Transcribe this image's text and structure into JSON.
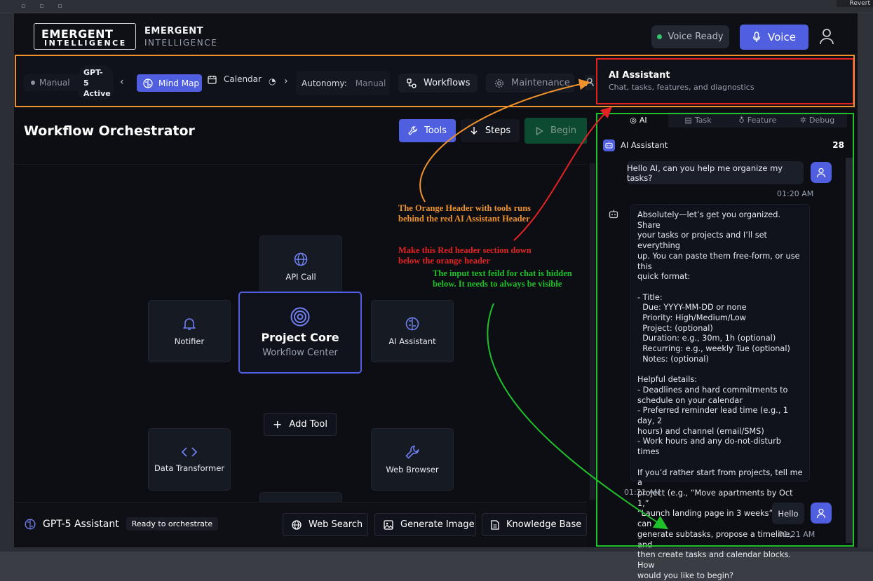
{
  "os": {
    "right_label": "Revert"
  },
  "header": {
    "logo_line1": "EMERGENT",
    "logo_line2": "INTELLIGENCE",
    "brand_title": "EMERGENT",
    "brand_subtitle": "INTELLIGENCE",
    "voice_status": "Voice Ready",
    "voice_button": "Voice"
  },
  "toolbar": {
    "mode": "Manual",
    "model_line1": "GPT-",
    "model_line2": "5",
    "model_line3": "Active",
    "mindmap": "Mind Map",
    "calendar": "Calendar",
    "autonomy_label": "Autonomy:",
    "autonomy_value": "Manual",
    "workflows": "Workflows",
    "maintenance": "Maintenance"
  },
  "assistant_header": {
    "title": "AI Assistant",
    "subtitle": "Chat, tasks, features, and diagnostics"
  },
  "workspace": {
    "title": "Workflow Orchestrator",
    "tools": "Tools",
    "steps": "Steps",
    "begin": "Begin",
    "nodes": {
      "api_call": "API Call",
      "notifier": "Notifier",
      "ai_assistant": "AI Assistant",
      "data_transformer": "Data Transformer",
      "web_browser": "Web Browser"
    },
    "core_title": "Project Core",
    "core_subtitle": "Workflow Center",
    "add_tool": "Add Tool"
  },
  "bottombar": {
    "assistant": "GPT-5 Assistant",
    "status": "Ready to orchestrate",
    "web_search": "Web Search",
    "generate_image": "Generate Image",
    "knowledge_base": "Knowledge Base"
  },
  "chat": {
    "tabs": [
      "AI",
      "Task",
      "Feature",
      "Debug"
    ],
    "header": "AI Assistant",
    "count": "28",
    "messages": [
      {
        "role": "user",
        "text": "Hello AI, can you help me organize my tasks?",
        "time": "01:20 AM"
      },
      {
        "role": "ai",
        "text": "Absolutely—let’s get you organized. Share\nyour tasks or projects and I’ll set everything\nup. You can paste them free-form, or use this\nquick format:\n\n- Title:\n  Due: YYYY-MM-DD or none\n  Priority: High/Medium/Low\n  Project: (optional)\n  Duration: e.g., 30m, 1h (optional)\n  Recurring: e.g., weekly Tue (optional)\n  Notes: (optional)\n\nHelpful details:\n- Deadlines and hard commitments to\nschedule on your calendar\n- Preferred reminder lead time (e.g., 1 day, 2\nhours) and channel (email/SMS)\n- Work hours and any do-not-disturb times\n\nIf you’d rather start from projects, tell me a\nproject (e.g., “Move apartments by Oct 1,”\n“Launch landing page in 3 weeks”), and I can\ngenerate subtasks, propose a timeline, and\nthen create tasks and calendar blocks. How\nwould you like to begin?",
        "time": "01:21 AM"
      },
      {
        "role": "user",
        "text": "Hello",
        "time": "01:21 AM"
      }
    ]
  },
  "annotations": {
    "orange": "The Orange Header with tools runs behind the red AI Assistant Header",
    "red": "Make this Red header section down below the orange header",
    "green": "The input text feild for chat is hidden below. It needs to always be visible"
  },
  "colors": {
    "accent": "#4f5fe0",
    "orange": "#f0922c",
    "red": "#e52222",
    "green": "#1fc12a",
    "background": "#0c0e14"
  }
}
